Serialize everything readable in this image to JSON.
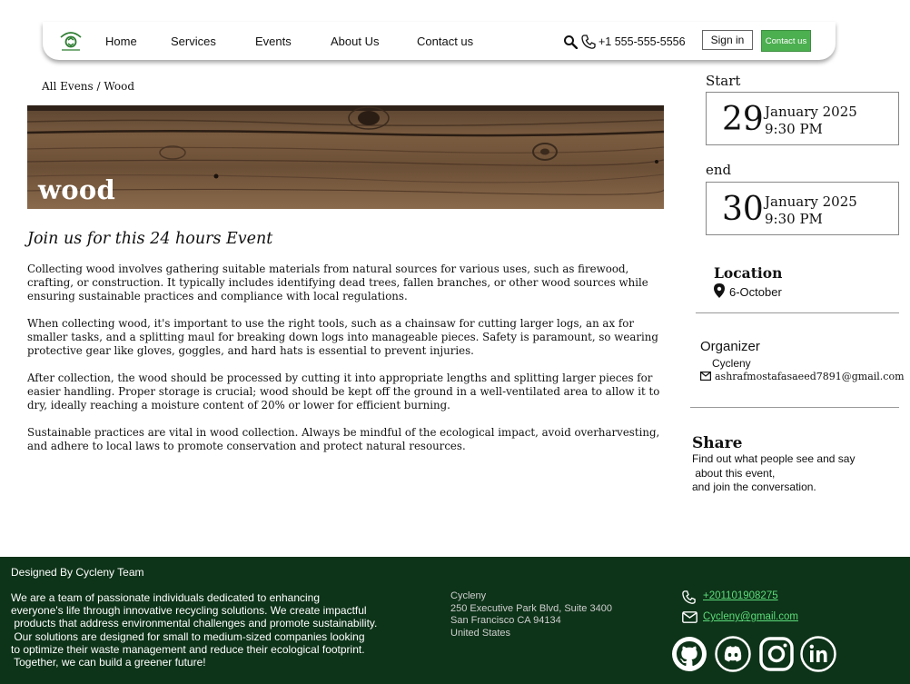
{
  "nav": {
    "links": [
      "Home",
      "Services",
      "Events",
      "About Us",
      "Contact us"
    ],
    "phone": "+1 555-555-5556",
    "signin_label": "Sign in",
    "contact_label": "Contact us",
    "search_icon": "search-icon",
    "phone_icon": "phone-icon"
  },
  "breadcrumb": {
    "parent": "All Evens",
    "separator": " / ",
    "current": "Wood"
  },
  "banner": {
    "title": "wood"
  },
  "event": {
    "heading": "Join us for this 24 hours Event",
    "paragraphs": [
      "Collecting wood involves gathering suitable materials from natural sources for various uses, such as firewood, crafting, or construction. It typically includes identifying dead trees, fallen branches, or other wood sources while ensuring sustainable practices and compliance with local regulations.",
      "When collecting wood, it's important to use the right tools, such as a chainsaw for cutting larger logs, an ax for smaller tasks, and a splitting maul for breaking down logs into manageable pieces. Safety is paramount, so wearing protective gear like gloves, goggles, and hard hats is essential to prevent injuries.",
      "After collection, the wood should be processed by cutting it into appropriate lengths and splitting larger pieces for easier handling. Proper storage is crucial; wood should be kept off the ground in a well-ventilated area to allow it to dry, ideally reaching a moisture content of 20% or lower for efficient burning.",
      "Sustainable practices are vital in wood collection. Always be mindful of the ecological impact, avoid overharvesting, and adhere to local laws to promote conservation and protect natural resources."
    ]
  },
  "start": {
    "label": "Start",
    "day": "29",
    "month": "January 2025",
    "time": "9:30 PM"
  },
  "end": {
    "label": "end",
    "day": "30",
    "month": "January 2025",
    "time": "9:30 PM"
  },
  "location": {
    "title": "Location",
    "value": "6-October"
  },
  "organizer": {
    "title": "Organizer",
    "name": "Cycleny",
    "email": "ashrafmostafasaeed7891@gmail.com"
  },
  "share": {
    "title": "Share",
    "text": "Find out what people see and say\n about this event,\nand join the conversation."
  },
  "footer": {
    "team": "Designed By Cycleny  Team",
    "about": "We are a team of passionate individuals dedicated to enhancing\neveryone's life through innovative recycling solutions. We create impactful\n products that address environmental challenges and promote sustainability.\n Our solutions are designed for small to medium-sized companies looking\nto optimize their waste management and reduce their ecological footprint.\n Together, we can build a greener future!",
    "address": "Cycleny\n250 Executive Park Blvd, Suite 3400\nSan Francisco CA 94134\nUnited States",
    "phone": "+201101908275",
    "email": "Cycleny@gmail.com",
    "social": [
      "github-icon",
      "discord-icon",
      "instagram-icon",
      "linkedin-icon"
    ]
  },
  "colors": {
    "accent_green": "#4caf50",
    "footer_bg": "#0d3318",
    "footer_link": "#5cdc7a"
  }
}
